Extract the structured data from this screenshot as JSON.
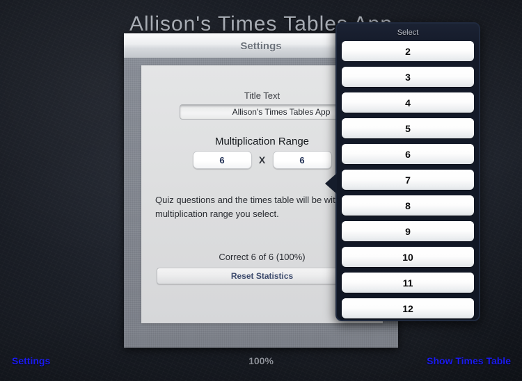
{
  "app": {
    "title": "Allison's Times Tables App"
  },
  "modal": {
    "header_title": "Settings",
    "title_text_label": "Title Text",
    "title_text_value": "Allison's Times Tables App",
    "multiplication_range_label": "Multiplication Range",
    "range_left_value": "6",
    "range_multiply_symbol": "X",
    "range_right_value": "6",
    "hint_text": "Quiz questions and the times table will be within the multiplication range you select.",
    "stats_text": "Correct 6 of 6 (100%)",
    "reset_button_label": "Reset Statistics"
  },
  "popover": {
    "title": "Select",
    "options": [
      "2",
      "3",
      "4",
      "5",
      "6",
      "7",
      "8",
      "9",
      "10",
      "11",
      "12"
    ]
  },
  "toolbar": {
    "settings_label": "Settings",
    "percent_label": "100%",
    "show_times_table_label": "Show Times Table"
  },
  "colors": {
    "link_blue": "#1b1bf0",
    "popover_navy": "#101623",
    "range_value_navy": "#243357",
    "reset_label_blue": "#3d4b6d"
  }
}
